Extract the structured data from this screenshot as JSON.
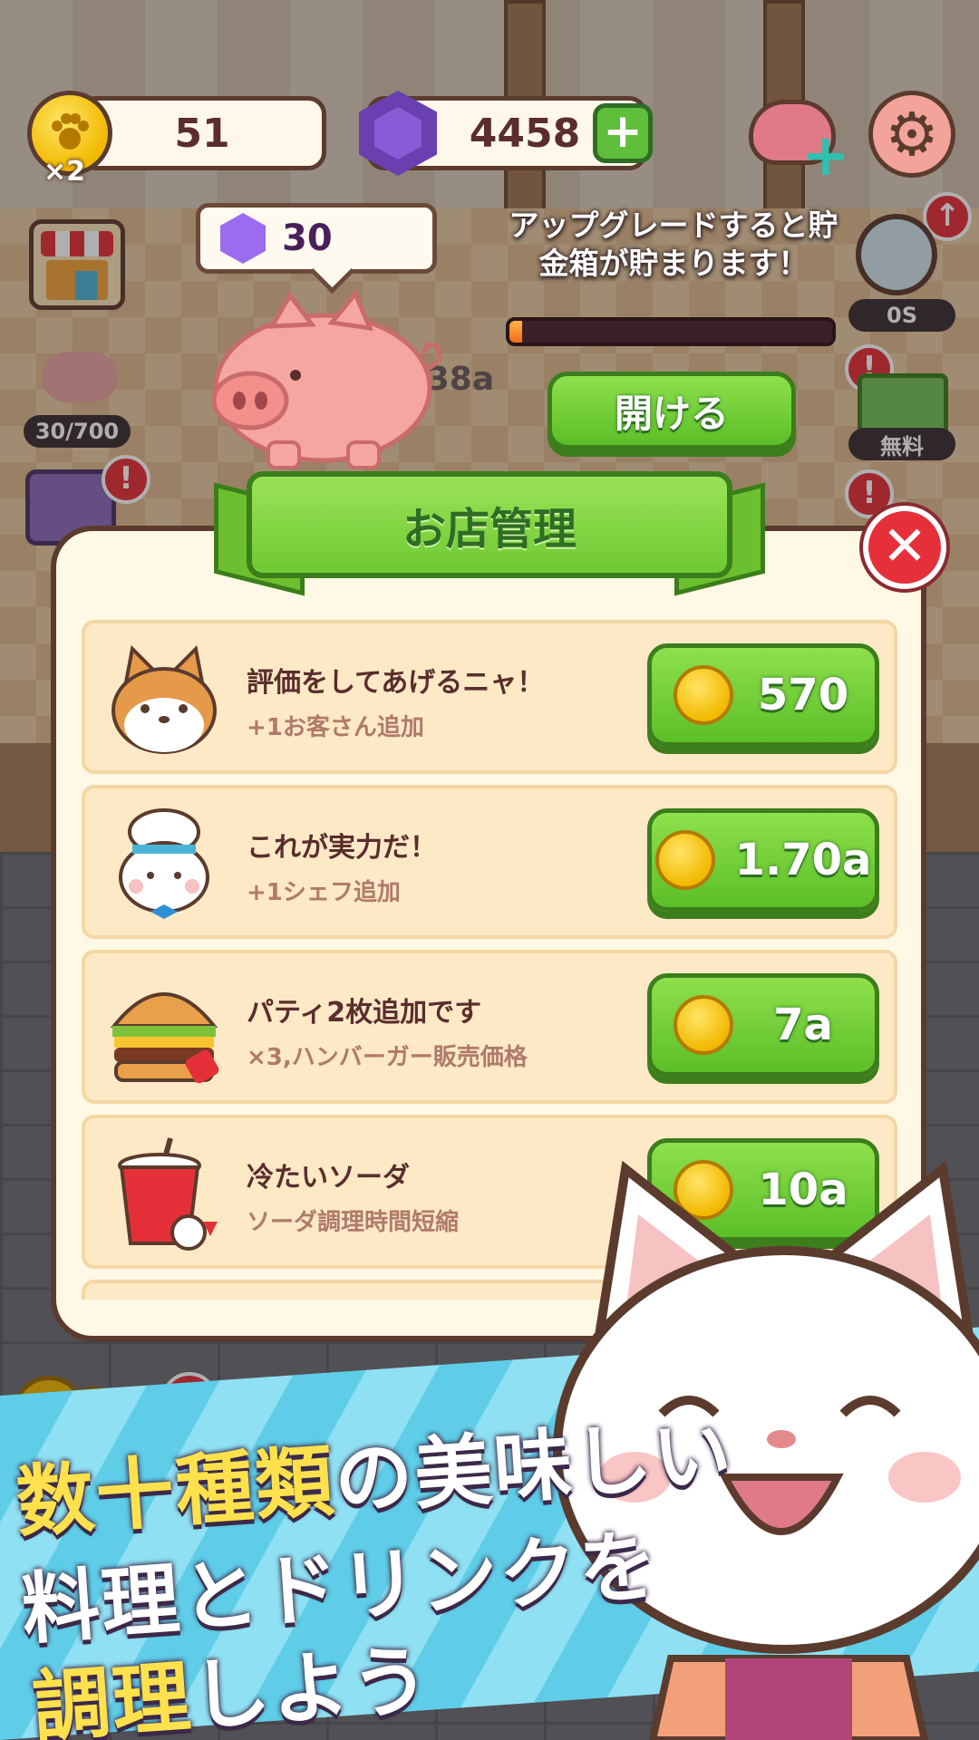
{
  "hud": {
    "coins": "51",
    "coin_multiplier": "×2",
    "gems": "4458"
  },
  "piggy_bank": {
    "gem_reward": "30",
    "info_line1": "アップグレードすると貯",
    "info_line2": "金箱が貯まります！",
    "progress_fraction": 0.04,
    "open_button": "開ける"
  },
  "side": {
    "piggy_counter": "30/700",
    "search_label": "0S",
    "free_label": "無料",
    "bg_price": "5.38a"
  },
  "panel": {
    "title": "お店管理",
    "upgrades": [
      {
        "title": "評価をしてあげるニャ！",
        "desc": "+1お客さん追加",
        "price": "570",
        "icon": "shiba-dog-icon"
      },
      {
        "title": "これが実力だ！",
        "desc": "+1シェフ追加",
        "price": "1.70a",
        "icon": "chef-cat-icon"
      },
      {
        "title": "パティ2枚追加です",
        "desc": "×3,ハンバーガー販売価格",
        "price": "7a",
        "icon": "burger-icon"
      },
      {
        "title": "冷たいソーダ",
        "desc": "ソーダ調理時間短縮",
        "price": "10a",
        "icon": "soda-icon"
      }
    ]
  },
  "promo": {
    "line1_highlight": "数十種類",
    "line1_rest": "の美味しい",
    "line2": "料理とドリンクを",
    "line3_highlight": "調理",
    "line3_rest": "しよう"
  },
  "colors": {
    "outline": "#5b3b2d",
    "green_button": "#6fc933",
    "panel_bg": "#fff8e4",
    "row_bg": "#fde9c6",
    "close_red": "#e5303a",
    "promo_yellow": "#ffe14d"
  }
}
